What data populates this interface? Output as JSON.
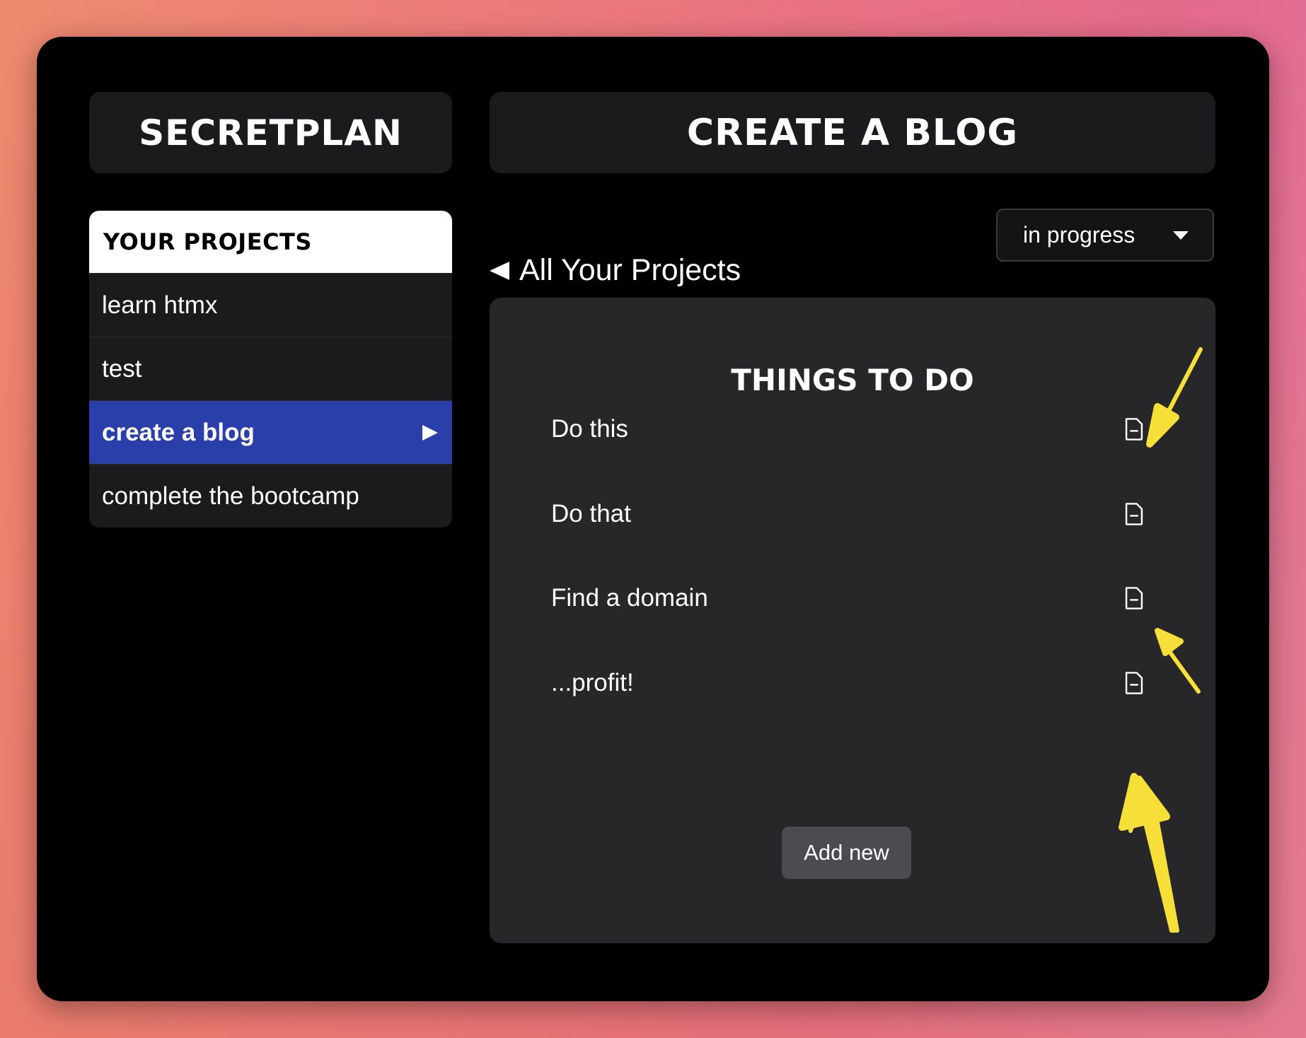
{
  "app": {
    "logo": "SECRETPLAN",
    "page_title": "CREATE A BLOG"
  },
  "sidebar": {
    "header": "YOUR PROJECTS",
    "items": [
      {
        "label": "learn htmx",
        "active": false
      },
      {
        "label": "test",
        "active": false
      },
      {
        "label": "create a blog",
        "active": true
      },
      {
        "label": "complete the bootcamp",
        "active": false
      }
    ]
  },
  "nav": {
    "back_label": "All Your Projects"
  },
  "status": {
    "selected": "in progress"
  },
  "todo": {
    "title": "THINGS TO DO",
    "items": [
      {
        "label": "Do this",
        "icon": "document-icon"
      },
      {
        "label": "Do that",
        "icon": "document-icon"
      },
      {
        "label": "Find a domain",
        "icon": "document-icon"
      },
      {
        "label": "...profit!",
        "icon": "document-icon"
      }
    ],
    "add_label": "Add new"
  },
  "colors": {
    "window_bg": "#000000",
    "panel_bg": "#27272a",
    "active_item": "#2a3faa",
    "annotation_arrow": "#f7df3a"
  }
}
